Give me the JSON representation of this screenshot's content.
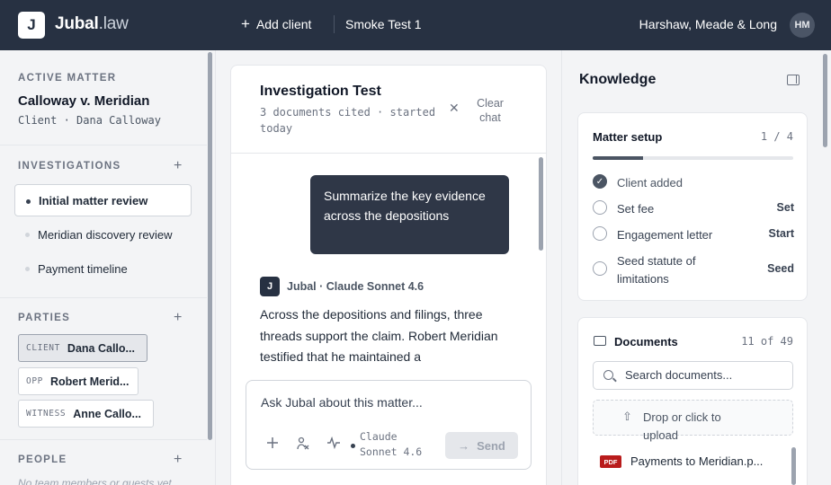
{
  "topbar": {
    "logo_letter": "J",
    "brand_main": "Jubal",
    "brand_suffix": ".law",
    "add_client_label": "Add client",
    "matter_name": "Smoke Test 1",
    "firm_name": "Harshaw, Meade & Long",
    "avatar_initials": "HM"
  },
  "sidebar": {
    "active_matter_label": "ACTIVE MATTER",
    "matter_title": "Calloway v. Meridian",
    "matter_client": "Client · Dana Calloway",
    "investigations_label": "INVESTIGATIONS",
    "investigations": [
      {
        "label": "Initial matter review",
        "active": true
      },
      {
        "label": "Meridian discovery review",
        "active": false
      },
      {
        "label": "Payment timeline",
        "active": false
      }
    ],
    "parties_label": "PARTIES",
    "parties": [
      {
        "role": "CLIENT",
        "name": "Dana Callo..."
      },
      {
        "role": "OPP",
        "name": "Robert Merid..."
      },
      {
        "role": "WITNESS",
        "name": "Anne Callo..."
      }
    ],
    "people_label": "PEOPLE",
    "people_empty": "No team members or guests yet"
  },
  "chat": {
    "title": "Investigation Test",
    "meta": "3 documents cited · started today",
    "clear_label": "Clear chat",
    "user_message": "Summarize the key evidence across the depositions",
    "bot_icon_letter": "J",
    "bot_name": "Jubal · Claude Sonnet 4.6",
    "bot_message": "Across the depositions and filings, three threads support the claim. Robert Meridian testified that he maintained a",
    "composer_placeholder": "Ask Jubal about this matter...",
    "model_label": "Claude Sonnet 4.6",
    "send_label": "Send"
  },
  "knowledge": {
    "title": "Knowledge",
    "setup_title": "Matter setup",
    "setup_count": "1 / 4",
    "setup_progress": 0.25,
    "tasks": [
      {
        "label": "Client added",
        "action": "",
        "done": true
      },
      {
        "label": "Set fee",
        "action": "Set",
        "done": false
      },
      {
        "label": "Engagement letter",
        "action": "Start",
        "done": false
      },
      {
        "label": "Seed statute of limitations",
        "action": "Seed",
        "done": false
      }
    ],
    "documents_title": "Documents",
    "documents_count": "11 of 49",
    "search_placeholder": "Search documents...",
    "drop_text": "Drop or click to upload",
    "documents": [
      {
        "badge": "PDF",
        "name": "Payments to Meridian.p..."
      }
    ]
  },
  "icons": {
    "plus": "plus-icon",
    "close": "close-icon",
    "attach": "attach-icon",
    "voice": "waveform-icon",
    "send_arrow": "arrow-right-icon",
    "panel_toggle": "panel-toggle-icon",
    "folder": "folder-icon",
    "search": "search-icon",
    "upload": "upload-icon",
    "check": "check-icon"
  },
  "colors": {
    "topbar_bg": "#273142",
    "user_bubble_bg": "#2f3747",
    "pdf_badge": "#b91c1c"
  }
}
